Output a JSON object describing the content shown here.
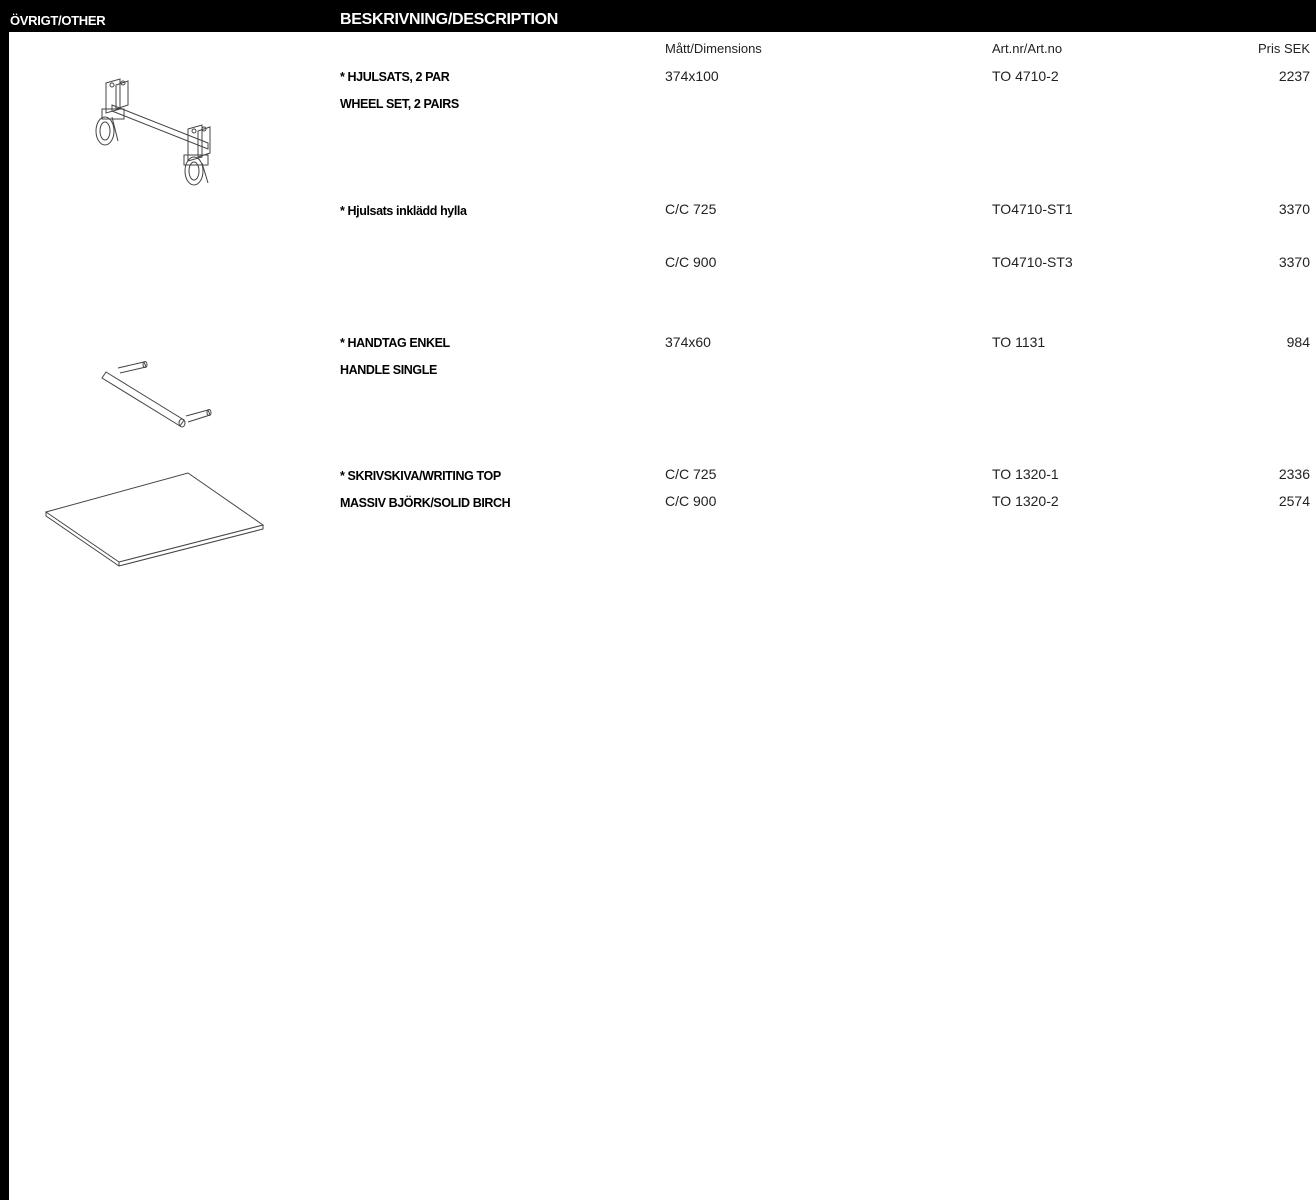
{
  "header": {
    "category": "ÖVRIGT/OTHER",
    "description": "BESKRIVNING/DESCRIPTION"
  },
  "columns": {
    "dimensions": "Mått/Dimensions",
    "article": "Art.nr/Art.no",
    "price": "Pris SEK"
  },
  "products": [
    {
      "icon": "wheel-set-icon",
      "line1": "* HJULSATS, 2 PAR",
      "line2": "WHEEL SET, 2 PAIRS",
      "rows": [
        {
          "dim": "374x100",
          "art": "TO 4710-2",
          "price": "2237"
        }
      ]
    },
    {
      "line1": "* Hjulsats inklädd hylla",
      "rows": [
        {
          "dim": "C/C 725",
          "art": "TO4710-ST1",
          "price": "3370"
        },
        {
          "dim": "C/C 900",
          "art": "TO4710-ST3",
          "price": "3370"
        }
      ]
    },
    {
      "icon": "handle-icon",
      "line1": "* HANDTAG ENKEL",
      "line2": "HANDLE SINGLE",
      "rows": [
        {
          "dim": "374x60",
          "art": "TO 1131",
          "price": "984"
        }
      ]
    },
    {
      "icon": "writing-top-icon",
      "line1": "* SKRIVSKIVA/WRITING TOP",
      "line2": "MASSIV BJÖRK/SOLID BIRCH",
      "rows": [
        {
          "dim": "C/C 725",
          "art": "TO 1320-1",
          "price": "2336"
        },
        {
          "dim": "C/C 900",
          "art": "TO 1320-2",
          "price": "2574"
        }
      ]
    }
  ]
}
